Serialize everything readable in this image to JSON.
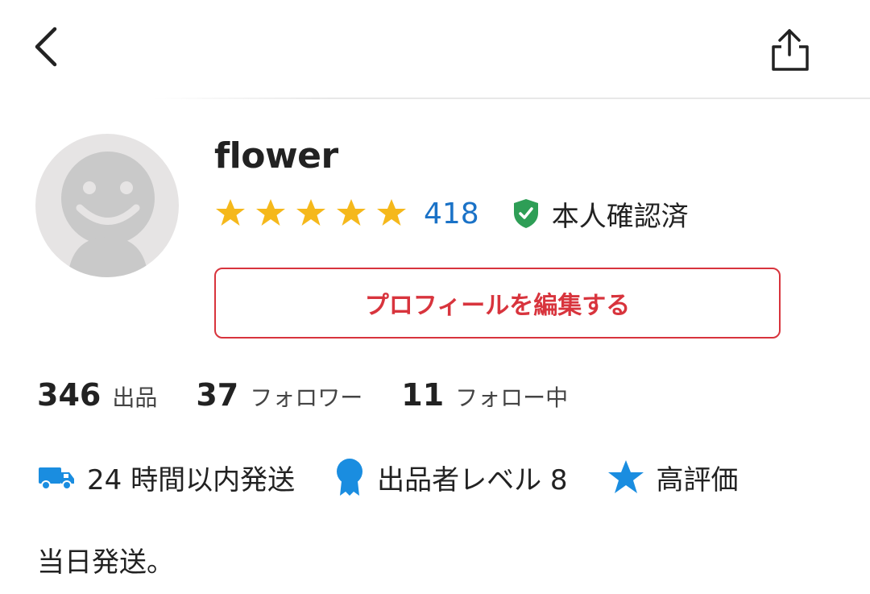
{
  "header": {
    "back_icon": "chevron-left-icon",
    "share_icon": "share-icon"
  },
  "profile": {
    "username": "flower",
    "rating_stars": 5,
    "review_count": "418",
    "verified_label": "本人確認済",
    "edit_button_label": "プロフィールを編集する"
  },
  "stats": [
    {
      "value": "346",
      "label": "出品"
    },
    {
      "value": "37",
      "label": "フォロワー"
    },
    {
      "value": "11",
      "label": "フォロー中"
    }
  ],
  "badges": [
    {
      "icon": "truck-icon",
      "label": "24 時間以内発送"
    },
    {
      "icon": "medal-icon",
      "label": "出品者レベル 8"
    },
    {
      "icon": "star-icon",
      "label": "高評価"
    }
  ],
  "bio": "当日発送。",
  "colors": {
    "star": "#f5b81b",
    "review_link": "#1a72c7",
    "verified": "#2e9e56",
    "accent_red": "#d8343d",
    "badge_blue": "#1a8de0"
  }
}
